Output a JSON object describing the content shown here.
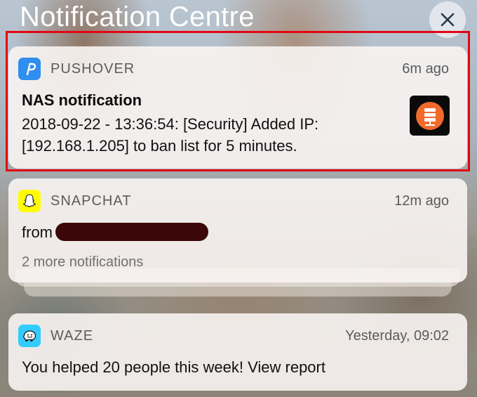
{
  "header": {
    "title": "Notification Centre",
    "close_icon": "close-icon"
  },
  "notifications": [
    {
      "app": "PUSHOVER",
      "app_icon": "pushover-icon",
      "icon_color": "#2f8ef0",
      "time": "6m ago",
      "title": "NAS notification",
      "body_lines": [
        "2018-09-22 - 13:36:54: [Security] Added IP:",
        "[192.168.1.205] to ban list for 5 minutes."
      ],
      "thumbnail_icon": "server-icon",
      "highlighted": true
    },
    {
      "app": "SNAPCHAT",
      "app_icon": "snapchat-ghost-icon",
      "icon_color": "#fffc00",
      "time": "12m ago",
      "body_prefix": "from",
      "more": "2 more notifications"
    },
    {
      "app": "WAZE",
      "app_icon": "waze-icon",
      "icon_color": "#33ccff",
      "time": "Yesterday, 09:02",
      "body": "You helped 20 people this week! View report"
    }
  ],
  "colors": {
    "highlight_border": "#e30613",
    "redaction": "#3b0708"
  }
}
